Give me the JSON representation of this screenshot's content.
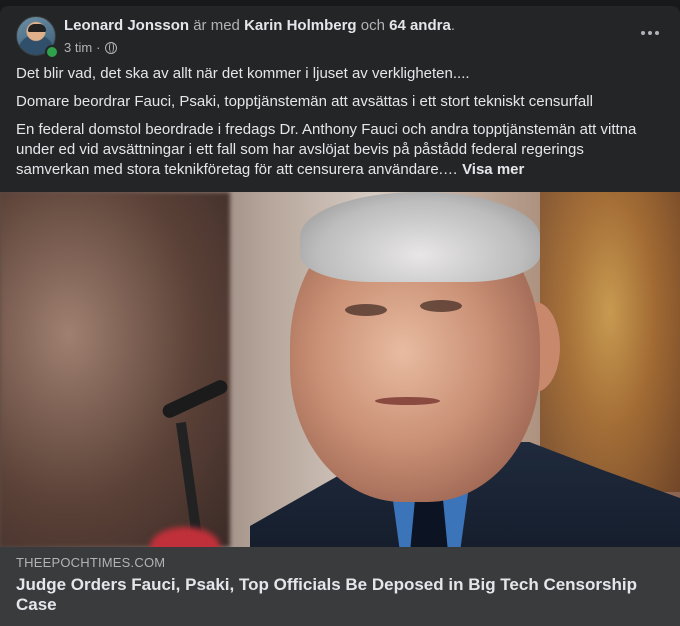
{
  "post": {
    "author": "Leonard Jonsson",
    "with_text": "är med",
    "tagged_person": "Karin Holmberg",
    "and_text": "och",
    "others": "64 andra",
    "period": ".",
    "time": "3 tim",
    "separator": "·",
    "privacy_icon": "globe-icon",
    "paragraphs": [
      "Det blir vad, det ska av allt när det kommer i ljuset av verkligheten....",
      "Domare beordrar Fauci, Psaki, topptjänstemän att avsättas i ett stort tekniskt censurfall",
      "En federal domstol beordrade i fredags Dr. Anthony Fauci och andra topptjänstemän att vittna under ed vid avsättningar i ett fall som har avslöjat bevis på påstådd federal regerings samverkan med stora teknikföretag för att censurera användare.…"
    ],
    "see_more": "Visa mer"
  },
  "link": {
    "domain": "THEEPOCHTIMES.COM",
    "title": "Judge Orders Fauci, Psaki, Top Officials Be Deposed in Big Tech Censorship Case"
  },
  "colors": {
    "card_bg": "#242526",
    "text": "#e4e6eb",
    "secondary_text": "#b0b3b8",
    "link_box_bg": "#3a3b3c",
    "online": "#31a24c"
  }
}
